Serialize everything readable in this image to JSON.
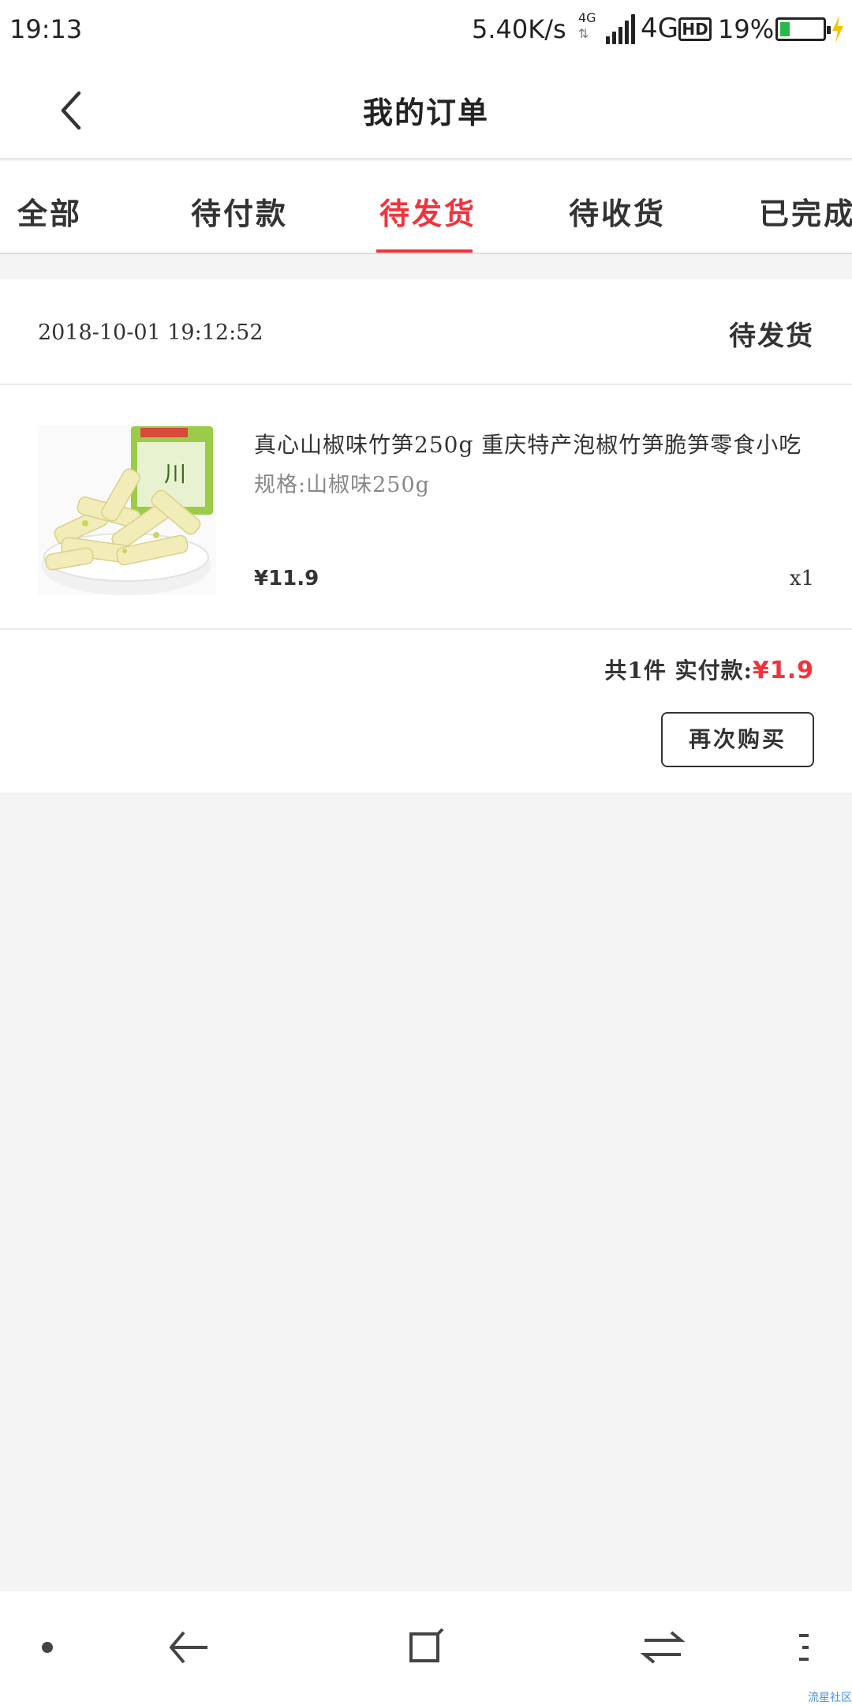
{
  "status_bar": {
    "time": "19:13",
    "net_speed": "5.40K/s",
    "net_small": "4G",
    "net_type": "4G",
    "hd": "HD",
    "battery_pct": "19%",
    "battery_level": 0.19
  },
  "header": {
    "title": "我的订单"
  },
  "tabs": [
    {
      "label": "全部"
    },
    {
      "label": "待付款"
    },
    {
      "label": "待发货"
    },
    {
      "label": "待收货"
    },
    {
      "label": "已完成"
    }
  ],
  "active_tab": "待发货",
  "order": {
    "date": "2018-10-01 19:12:52",
    "status": "待发货",
    "item": {
      "name": "真心山椒味竹笋250g 重庆特产泡椒竹笋脆笋零食小吃",
      "spec": "规格:山椒味250g",
      "price": "¥11.9",
      "qty": "x1"
    },
    "summary_label": "共1件 实付款:",
    "paid_amount": "¥1.9",
    "rebuy_label": "再次购买"
  },
  "watermark": "流星社区",
  "colors": {
    "accent": "#f0343c",
    "background": "#f4f4f4"
  }
}
